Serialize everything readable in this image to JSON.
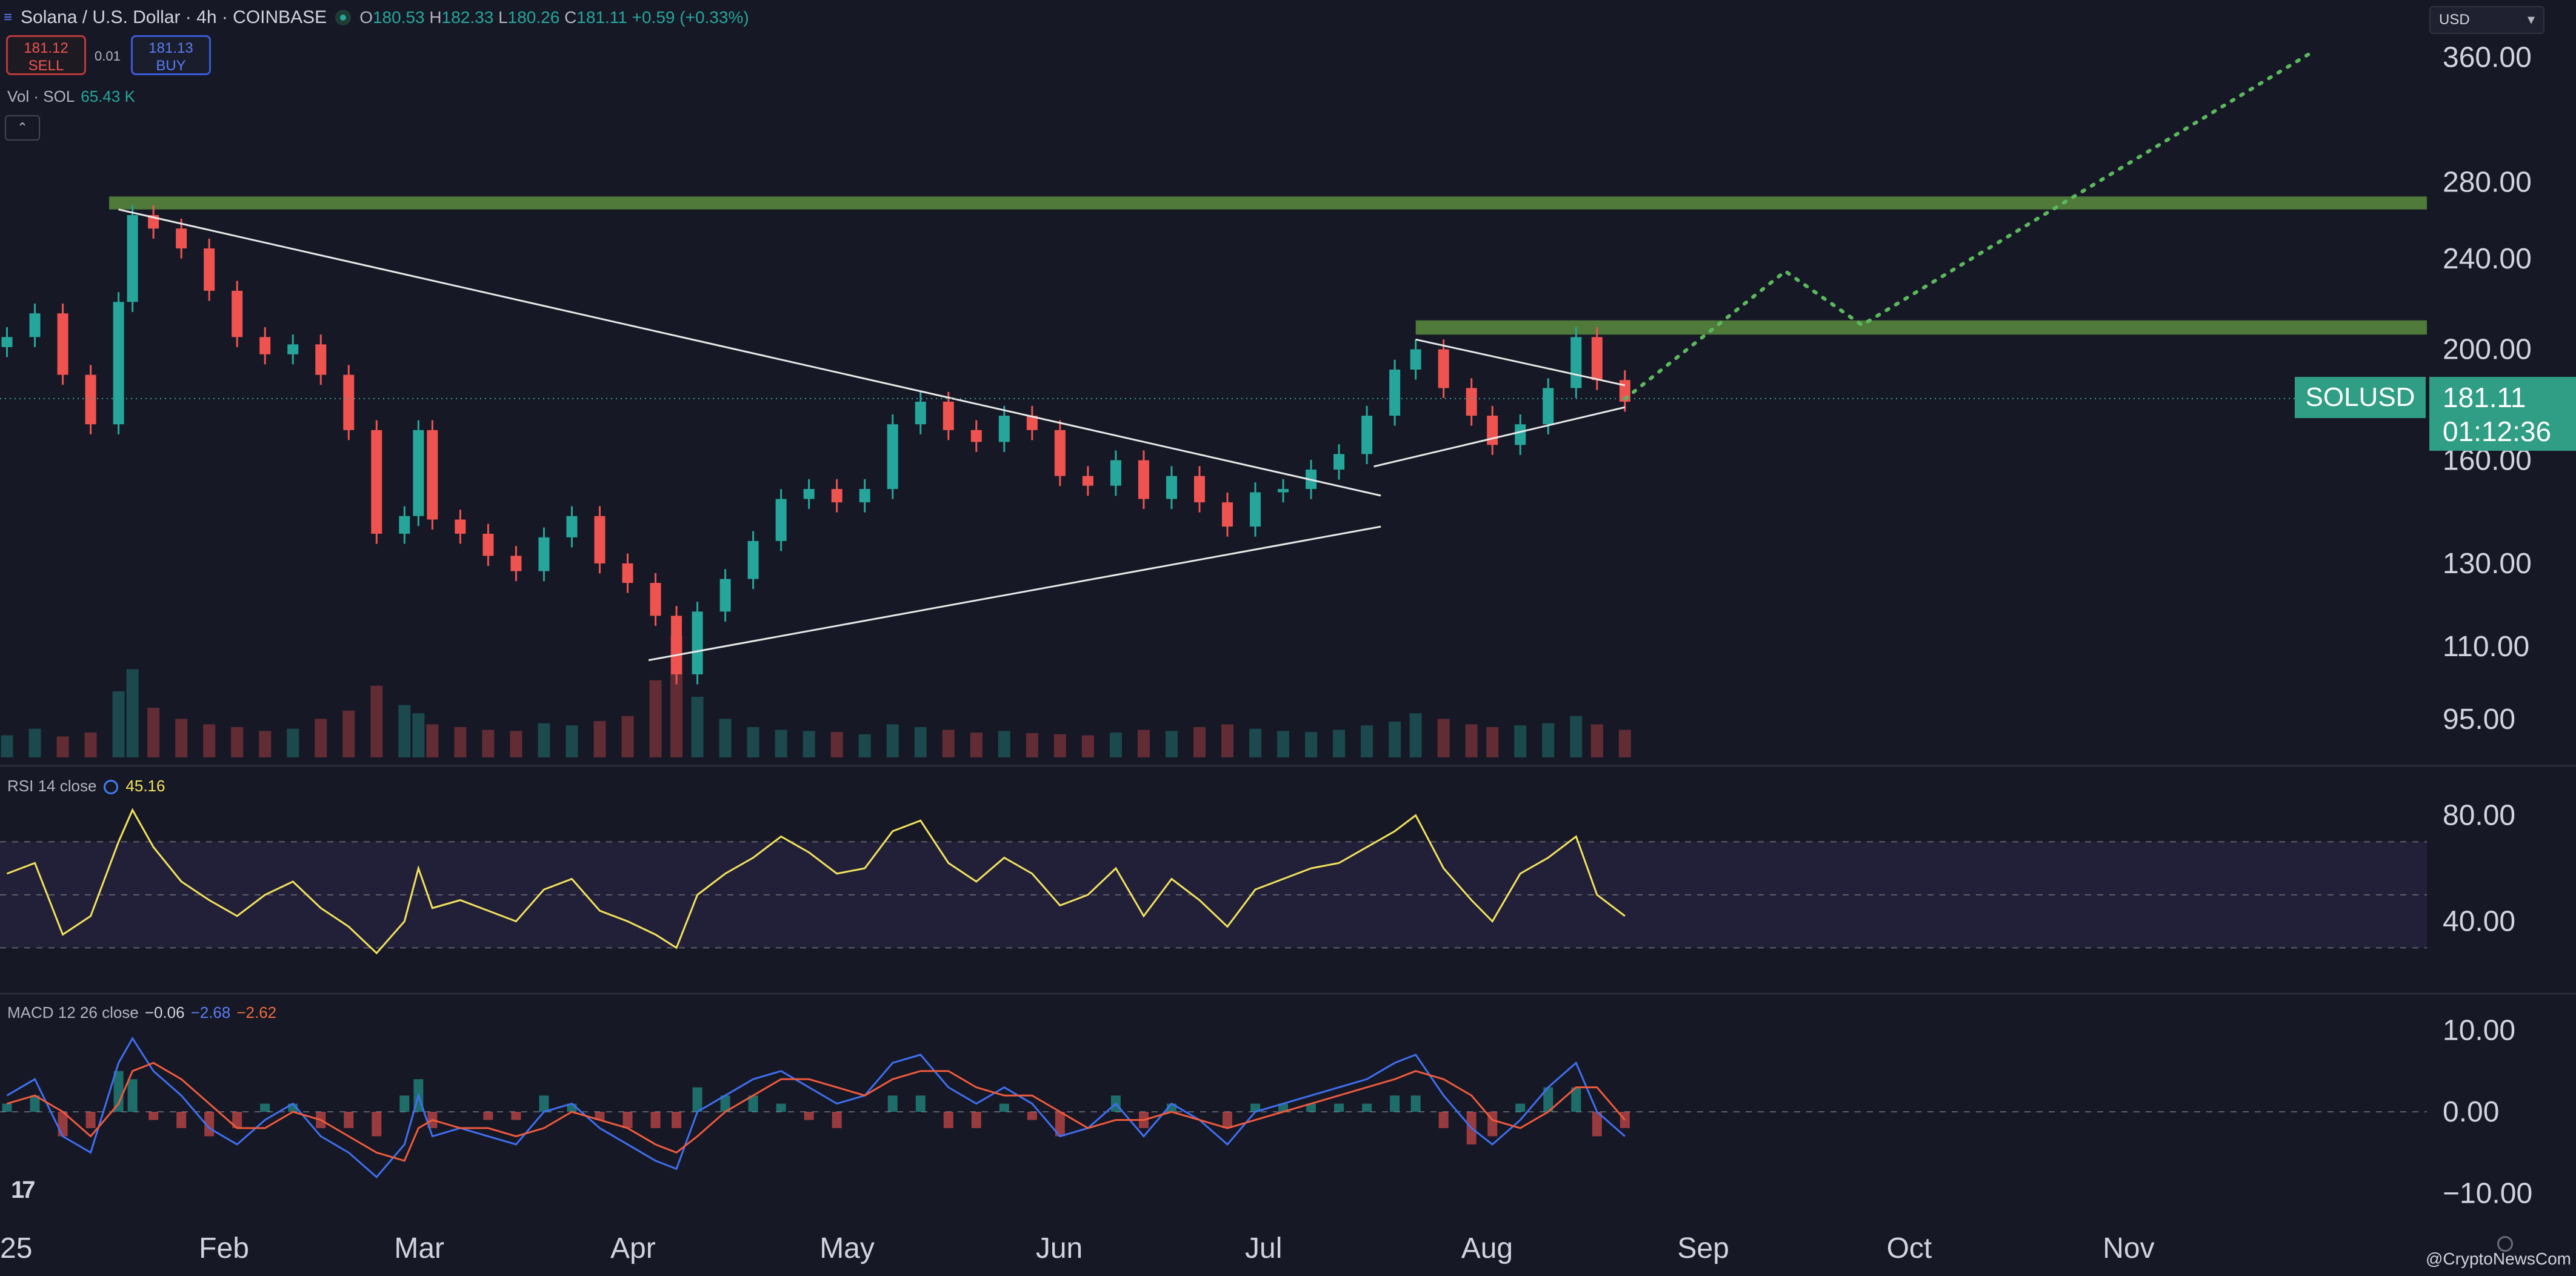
{
  "header": {
    "title": "Solana / U.S. Dollar · 4h · COINBASE",
    "o_label": "O",
    "o": "180.53",
    "h_label": "H",
    "h": "182.33",
    "l_label": "L",
    "l": "180.26",
    "c_label": "C",
    "c": "181.11",
    "change": "+0.59 (+0.33%)"
  },
  "trade": {
    "sell_price": "181.12",
    "sell_label": "SELL",
    "spread": "0.01",
    "buy_price": "181.13",
    "buy_label": "BUY"
  },
  "volume_label": {
    "name": "Vol · SOL",
    "value": "65.43 K"
  },
  "rsi_label": {
    "name": "RSI 14 close",
    "value": "45.16"
  },
  "macd_label": {
    "name": "MACD 12 26 close",
    "macd": "−0.06",
    "signal": "−2.68",
    "hist": "−2.62"
  },
  "currency_select": "USD",
  "symbol_tag": "SOLUSD",
  "price_tag": {
    "price": "181.11",
    "countdown": "01:12:36"
  },
  "watermark": "@CryptoNewsCom",
  "colors": {
    "up": "#26a69a",
    "down": "#ef5350",
    "rsi": "#f2e25c",
    "macd": "#3f6ff0",
    "signal": "#ef5a3c",
    "zone": "#4f7a3a",
    "projection": "#5cb85c",
    "trendline": "#e8e8e8"
  },
  "chart_data": [
    {
      "type": "line",
      "title": "Solana / U.S. Dollar · 4h · COINBASE",
      "x_ticks": [
        "25",
        "Feb",
        "Mar",
        "Apr",
        "May",
        "Jun",
        "Jul",
        "Aug",
        "Sep",
        "Oct",
        "Nov"
      ],
      "y_ticks": [
        "95.00",
        "110.00",
        "130.00",
        "160.00",
        "200.00",
        "240.00",
        "280.00",
        "360.00"
      ],
      "ylim": [
        88,
        380
      ],
      "scale": "log",
      "series": [
        {
          "x": [
            "2025-01-01",
            "2025-01-05",
            "2025-01-09",
            "2025-01-13",
            "2025-01-17",
            "2025-01-19",
            "2025-01-22",
            "2025-01-26",
            "2025-01-30",
            "2025-02-03",
            "2025-02-07",
            "2025-02-11",
            "2025-02-15",
            "2025-02-19",
            "2025-02-23",
            "2025-02-27",
            "2025-03-01",
            "2025-03-03",
            "2025-03-07",
            "2025-03-11",
            "2025-03-15",
            "2025-03-19",
            "2025-03-23",
            "2025-03-27",
            "2025-03-31",
            "2025-04-04",
            "2025-04-07",
            "2025-04-10",
            "2025-04-14",
            "2025-04-18",
            "2025-04-22",
            "2025-04-26",
            "2025-04-30",
            "2025-05-04",
            "2025-05-08",
            "2025-05-12",
            "2025-05-16",
            "2025-05-20",
            "2025-05-24",
            "2025-05-28",
            "2025-06-01",
            "2025-06-05",
            "2025-06-09",
            "2025-06-13",
            "2025-06-17",
            "2025-06-21",
            "2025-06-25",
            "2025-06-29",
            "2025-07-03",
            "2025-07-07",
            "2025-07-11",
            "2025-07-15",
            "2025-07-19",
            "2025-07-22",
            "2025-07-26",
            "2025-07-30",
            "2025-08-02",
            "2025-08-06",
            "2025-08-10",
            "2025-08-14",
            "2025-08-17",
            "2025-08-21"
          ],
          "values": [
            205,
            215,
            190,
            172,
            220,
            262,
            255,
            245,
            225,
            205,
            198,
            202,
            190,
            170,
            138,
            143,
            170,
            142,
            138,
            132,
            128,
            137,
            143,
            130,
            125,
            117,
            104,
            118,
            126,
            136,
            148,
            151,
            147,
            151,
            172,
            180,
            170,
            166,
            175,
            170,
            155,
            152,
            160,
            148,
            155,
            147,
            140,
            150,
            151,
            157,
            162,
            175,
            192,
            200,
            185,
            175,
            165,
            172,
            185,
            205,
            188,
            180
          ]
        }
      ],
      "annotations": [
        {
          "type": "zone",
          "y_from": 265,
          "y_to": 272
        },
        {
          "type": "zone",
          "y_from": 206,
          "y_to": 212
        },
        {
          "type": "trendline",
          "from": [
            "2025-01-17",
            265
          ],
          "to": [
            "2025-07-17",
            149
          ]
        },
        {
          "type": "trendline",
          "from": [
            "2025-04-03",
            107
          ],
          "to": [
            "2025-07-17",
            140
          ]
        },
        {
          "type": "trendline",
          "from": [
            "2025-07-22",
            204
          ],
          "to": [
            "2025-08-21",
            186
          ]
        },
        {
          "type": "trendline",
          "from": [
            "2025-07-16",
            158
          ],
          "to": [
            "2025-08-21",
            178
          ]
        },
        {
          "type": "projection",
          "points": [
            [
              "2025-08-21",
              181
            ],
            [
              "2025-09-13",
              234
            ],
            [
              "2025-09-24",
              210
            ],
            [
              "2025-11-27",
              362
            ]
          ]
        },
        {
          "type": "last_price",
          "y": 181.11
        }
      ]
    },
    {
      "type": "bar",
      "title": "Vol · SOL",
      "values": [
        40,
        52,
        38,
        45,
        120,
        160,
        90,
        70,
        60,
        55,
        48,
        52,
        70,
        85,
        130,
        95,
        80,
        60,
        55,
        50,
        48,
        62,
        58,
        66,
        75,
        140,
        220,
        110,
        70,
        55,
        50,
        48,
        46,
        42,
        60,
        55,
        50,
        45,
        48,
        44,
        42,
        40,
        45,
        50,
        48,
        55,
        60,
        52,
        48,
        46,
        50,
        58,
        65,
        80,
        70,
        60,
        55,
        58,
        62,
        75,
        60,
        50
      ]
    },
    {
      "type": "line",
      "title": "RSI 14 close",
      "y_ticks": [
        "40.00",
        "80.00"
      ],
      "ylim": [
        15,
        95
      ],
      "bands": [
        30,
        50,
        70
      ],
      "series": [
        {
          "name": "RSI",
          "values": [
            58,
            62,
            35,
            42,
            70,
            82,
            68,
            55,
            48,
            42,
            50,
            55,
            45,
            38,
            28,
            40,
            60,
            45,
            48,
            44,
            40,
            52,
            56,
            44,
            40,
            35,
            30,
            50,
            58,
            64,
            72,
            66,
            58,
            60,
            74,
            78,
            62,
            55,
            64,
            58,
            46,
            50,
            60,
            42,
            56,
            48,
            38,
            52,
            56,
            60,
            62,
            68,
            74,
            80,
            60,
            48,
            40,
            58,
            64,
            72,
            50,
            42
          ]
        }
      ]
    },
    {
      "type": "line",
      "title": "MACD 12 26 close",
      "y_ticks": [
        "10.00",
        "0.00",
        "−10.00"
      ],
      "ylim": [
        -13,
        13
      ],
      "series": [
        {
          "name": "MACD",
          "values": [
            2,
            4,
            -3,
            -5,
            6,
            9,
            5,
            2,
            -2,
            -4,
            -1,
            1,
            -3,
            -5,
            -8,
            -4,
            2,
            -3,
            -2,
            -3,
            -4,
            0,
            1,
            -2,
            -4,
            -6,
            -7,
            0,
            2,
            4,
            5,
            3,
            1,
            2,
            6,
            7,
            3,
            1,
            3,
            1,
            -3,
            -2,
            1,
            -3,
            1,
            -1,
            -4,
            0,
            1,
            2,
            3,
            4,
            6,
            7,
            2,
            -2,
            -4,
            -1,
            3,
            6,
            0,
            -3
          ]
        },
        {
          "name": "Signal",
          "values": [
            1,
            2,
            0,
            -3,
            1,
            5,
            6,
            4,
            1,
            -2,
            -2,
            0,
            -1,
            -3,
            -5,
            -6,
            -2,
            -1,
            -2,
            -2,
            -3,
            -2,
            0,
            -1,
            -2,
            -4,
            -5,
            -3,
            0,
            2,
            4,
            4,
            3,
            2,
            4,
            5,
            5,
            3,
            2,
            2,
            0,
            -2,
            -1,
            -1,
            0,
            -1,
            -2,
            -1,
            0,
            1,
            2,
            3,
            4,
            5,
            4,
            2,
            -1,
            -2,
            0,
            3,
            3,
            -1
          ]
        }
      ]
    }
  ]
}
